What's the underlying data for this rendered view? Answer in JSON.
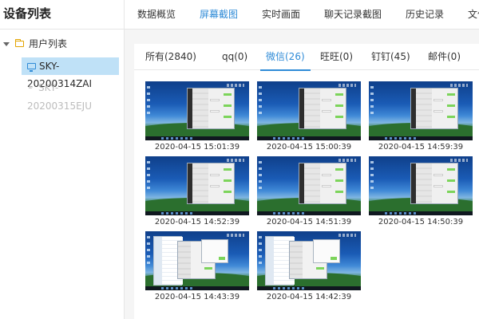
{
  "sidebar": {
    "title": "设备列表",
    "group_label": "用户列表",
    "devices": [
      {
        "name": "SKY-20200314ZAI",
        "status": "online"
      },
      {
        "name": "SKY-20200315EJU",
        "status": "offline"
      }
    ]
  },
  "topnav": {
    "tabs": [
      {
        "label": "数据概览",
        "active": false
      },
      {
        "label": "屏幕截图",
        "active": true
      },
      {
        "label": "实时画面",
        "active": false
      },
      {
        "label": "聊天记录截图",
        "active": false
      },
      {
        "label": "历史记录",
        "active": false
      },
      {
        "label": "文件",
        "active": false
      }
    ]
  },
  "subtabs": [
    {
      "label": "所有(2840)",
      "active": false
    },
    {
      "label": "qq(0)",
      "active": false
    },
    {
      "label": "微信(26)",
      "active": true
    },
    {
      "label": "旺旺(0)",
      "active": false
    },
    {
      "label": "钉钉(45)",
      "active": false
    },
    {
      "label": "邮件(0)",
      "active": false
    }
  ],
  "screenshots": [
    {
      "time": "2020-04-15 15:01:39",
      "style": "wechat"
    },
    {
      "time": "2020-04-15 15:00:39",
      "style": "wechat"
    },
    {
      "time": "2020-04-15 14:59:39",
      "style": "wechat"
    },
    {
      "time": "2020-04-15 14:52:39",
      "style": "wechat"
    },
    {
      "time": "2020-04-15 14:51:39",
      "style": "wechat"
    },
    {
      "time": "2020-04-15 14:50:39",
      "style": "wechat"
    },
    {
      "time": "2020-04-15 14:43:39",
      "style": "explorer"
    },
    {
      "time": "2020-04-15 14:42:39",
      "style": "explorer"
    }
  ],
  "colors": {
    "accent": "#2f8bd7",
    "selected_bg": "#bfe1f7",
    "chat_green": "#7cd45a"
  }
}
